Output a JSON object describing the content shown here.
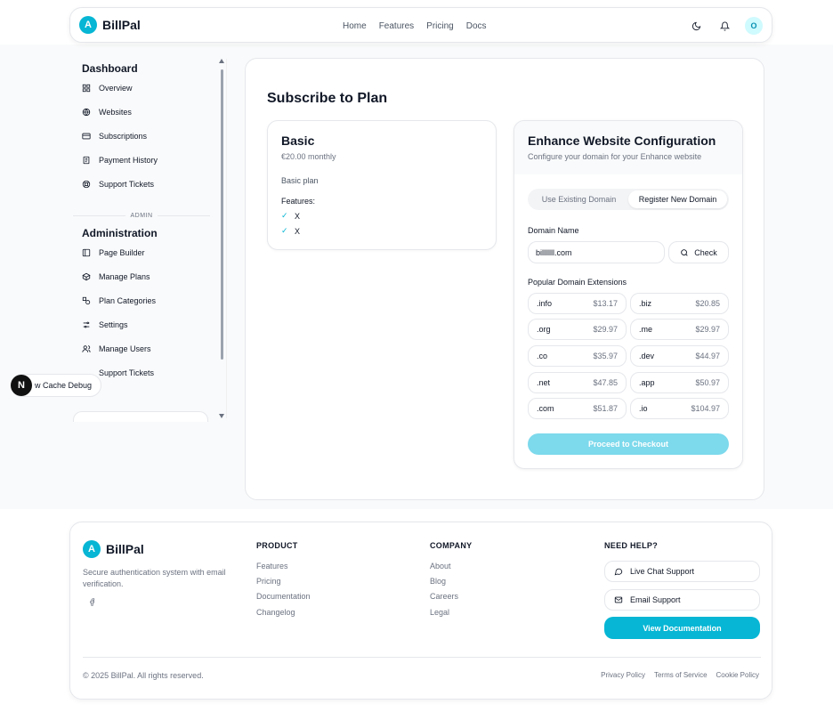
{
  "header": {
    "logo_letter": "A",
    "brand": "BillPal",
    "nav": [
      "Home",
      "Features",
      "Pricing",
      "Docs"
    ],
    "avatar_letter": "O",
    "icons": [
      "moon-icon",
      "bell-icon"
    ]
  },
  "sidebar": {
    "dashboard_title": "Dashboard",
    "dashboard_items": [
      {
        "label": "Overview",
        "icon": "grid-icon"
      },
      {
        "label": "Websites",
        "icon": "globe-icon"
      },
      {
        "label": "Subscriptions",
        "icon": "card-icon"
      },
      {
        "label": "Payment History",
        "icon": "receipt-icon"
      },
      {
        "label": "Support Tickets",
        "icon": "lifebuoy-icon"
      }
    ],
    "divider_label": "ADMIN",
    "admin_title": "Administration",
    "admin_items": [
      {
        "label": "Page Builder",
        "icon": "layout-icon"
      },
      {
        "label": "Manage Plans",
        "icon": "box-icon"
      },
      {
        "label": "Plan Categories",
        "icon": "shapes-icon"
      },
      {
        "label": "Settings",
        "icon": "sliders-icon"
      },
      {
        "label": "Manage Users",
        "icon": "users-icon"
      },
      {
        "label": "Support Tickets",
        "icon": "ticket-icon"
      }
    ]
  },
  "debug": {
    "badge_letter": "N",
    "label": "w Cache Debug"
  },
  "main": {
    "title": "Subscribe to Plan",
    "plan": {
      "name": "Basic",
      "price": "€20.00 monthly",
      "description": "Basic plan",
      "features_title": "Features:",
      "features": [
        "X",
        "X"
      ]
    },
    "config": {
      "title": "Enhance Website Configuration",
      "subtitle": "Configure your domain for your Enhance website",
      "tabs": [
        "Use Existing Domain",
        "Register New Domain"
      ],
      "active_tab": "Register New Domain",
      "domain_label": "Domain Name",
      "domain_value": "billlllll.com",
      "check_label": "Check",
      "extensions_label": "Popular Domain Extensions",
      "extensions": [
        {
          "name": ".info",
          "price": "$13.17"
        },
        {
          "name": ".biz",
          "price": "$20.85"
        },
        {
          "name": ".org",
          "price": "$29.97"
        },
        {
          "name": ".me",
          "price": "$29.97"
        },
        {
          "name": ".co",
          "price": "$35.97"
        },
        {
          "name": ".dev",
          "price": "$44.97"
        },
        {
          "name": ".net",
          "price": "$47.85"
        },
        {
          "name": ".app",
          "price": "$50.97"
        },
        {
          "name": ".com",
          "price": "$51.87"
        },
        {
          "name": ".io",
          "price": "$104.97"
        }
      ],
      "checkout_label": "Proceed to Checkout"
    }
  },
  "footer": {
    "brand": "BillPal",
    "logo_letter": "A",
    "tagline": "Secure authentication system with email verification.",
    "product_title": "PRODUCT",
    "product_links": [
      "Features",
      "Pricing",
      "Documentation",
      "Changelog"
    ],
    "company_title": "COMPANY",
    "company_links": [
      "About",
      "Blog",
      "Careers",
      "Legal"
    ],
    "help_title": "NEED HELP?",
    "live_chat": "Live Chat Support",
    "email_support": "Email Support",
    "docs_button": "View Documentation",
    "copyright": "© 2025 BillPal. All rights reserved.",
    "legal_links": [
      "Privacy Policy",
      "Terms of Service",
      "Cookie Policy"
    ]
  },
  "colors": {
    "accent": "#06b6d4",
    "accent_light": "#7dd9ec"
  }
}
